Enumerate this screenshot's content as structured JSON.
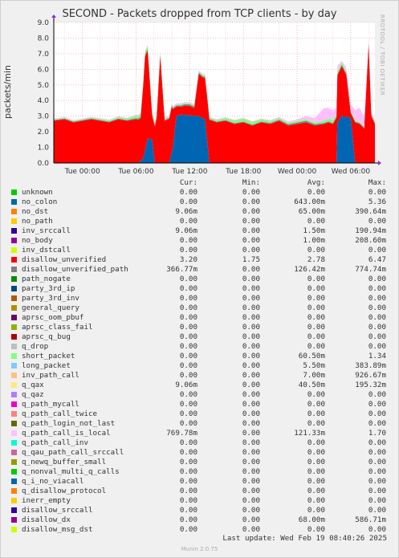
{
  "title": "SECOND - Packets dropped from TCP clients - by day",
  "side_credit": "RRDTOOL / TOBI OETIKER",
  "footer": {
    "last_update": "Last update: Wed Feb 19 08:40:26 2025",
    "generator": "Munin 2.0.75"
  },
  "legend_header": {
    "cur": "Cur:",
    "min": "Min:",
    "avg": "Avg:",
    "max": "Max:"
  },
  "legend": [
    {
      "name": "unknown",
      "color": "#00cc00",
      "cur": "0.00",
      "min": "0.00",
      "avg": "0.00",
      "max": "0.00"
    },
    {
      "name": "no_colon",
      "color": "#0066b3",
      "cur": "0.00",
      "min": "0.00",
      "avg": "643.00m",
      "max": "5.36"
    },
    {
      "name": "no_dst",
      "color": "#ff8000",
      "cur": "9.06m",
      "min": "0.00",
      "avg": "65.00m",
      "max": "390.64m"
    },
    {
      "name": "no_path",
      "color": "#ffcc00",
      "cur": "0.00",
      "min": "0.00",
      "avg": "0.00",
      "max": "0.00"
    },
    {
      "name": "inv_srccall",
      "color": "#330099",
      "cur": "9.06m",
      "min": "0.00",
      "avg": "1.50m",
      "max": "190.94m"
    },
    {
      "name": "no_body",
      "color": "#990099",
      "cur": "0.00",
      "min": "0.00",
      "avg": "1.00m",
      "max": "208.60m"
    },
    {
      "name": "inv_dstcall",
      "color": "#ccff00",
      "cur": "0.00",
      "min": "0.00",
      "avg": "0.00",
      "max": "0.00"
    },
    {
      "name": "disallow_unverified",
      "color": "#ff0000",
      "cur": "3.20",
      "min": "1.75",
      "avg": "2.78",
      "max": "6.47"
    },
    {
      "name": "disallow_unverified_path",
      "color": "#808080",
      "cur": "366.77m",
      "min": "0.00",
      "avg": "126.42m",
      "max": "774.74m"
    },
    {
      "name": "path_nogate",
      "color": "#008f00",
      "cur": "0.00",
      "min": "0.00",
      "avg": "0.00",
      "max": "0.00"
    },
    {
      "name": "party_3rd_ip",
      "color": "#00487d",
      "cur": "0.00",
      "min": "0.00",
      "avg": "0.00",
      "max": "0.00"
    },
    {
      "name": "party_3rd_inv",
      "color": "#b35a00",
      "cur": "0.00",
      "min": "0.00",
      "avg": "0.00",
      "max": "0.00"
    },
    {
      "name": "general_query",
      "color": "#b38f00",
      "cur": "0.00",
      "min": "0.00",
      "avg": "0.00",
      "max": "0.00"
    },
    {
      "name": "aprsc_oom_pbuf",
      "color": "#6b006b",
      "cur": "0.00",
      "min": "0.00",
      "avg": "0.00",
      "max": "0.00"
    },
    {
      "name": "aprsc_class_fail",
      "color": "#8fb300",
      "cur": "0.00",
      "min": "0.00",
      "avg": "0.00",
      "max": "0.00"
    },
    {
      "name": "aprsc_q_bug",
      "color": "#b30000",
      "cur": "0.00",
      "min": "0.00",
      "avg": "0.00",
      "max": "0.00"
    },
    {
      "name": "q_drop",
      "color": "#bebebe",
      "cur": "0.00",
      "min": "0.00",
      "avg": "0.00",
      "max": "0.00"
    },
    {
      "name": "short_packet",
      "color": "#80ff80",
      "cur": "0.00",
      "min": "0.00",
      "avg": "60.50m",
      "max": "1.34"
    },
    {
      "name": "long_packet",
      "color": "#80c9ff",
      "cur": "0.00",
      "min": "0.00",
      "avg": "5.50m",
      "max": "383.89m"
    },
    {
      "name": "inv_path_call",
      "color": "#ffc080",
      "cur": "0.00",
      "min": "0.00",
      "avg": "7.00m",
      "max": "926.67m"
    },
    {
      "name": "q_qax",
      "color": "#ffe680",
      "cur": "9.06m",
      "min": "0.00",
      "avg": "40.50m",
      "max": "195.32m"
    },
    {
      "name": "q_qaz",
      "color": "#aa80ff",
      "cur": "0.00",
      "min": "0.00",
      "avg": "0.00",
      "max": "0.00"
    },
    {
      "name": "q_path_mycall",
      "color": "#ee00cc",
      "cur": "0.00",
      "min": "0.00",
      "avg": "0.00",
      "max": "0.00"
    },
    {
      "name": "q_path_call_twice",
      "color": "#ff8080",
      "cur": "0.00",
      "min": "0.00",
      "avg": "0.00",
      "max": "0.00"
    },
    {
      "name": "q_path_login_not_last",
      "color": "#666600",
      "cur": "0.00",
      "min": "0.00",
      "avg": "0.00",
      "max": "0.00"
    },
    {
      "name": "q_path_call_is_local",
      "color": "#ffbfff",
      "cur": "769.78m",
      "min": "0.00",
      "avg": "121.33m",
      "max": "1.70"
    },
    {
      "name": "q_path_call_inv",
      "color": "#00ffcc",
      "cur": "0.00",
      "min": "0.00",
      "avg": "0.00",
      "max": "0.00"
    },
    {
      "name": "q_qau_path_call_srccall",
      "color": "#cc6699",
      "cur": "0.00",
      "min": "0.00",
      "avg": "0.00",
      "max": "0.00"
    },
    {
      "name": "q_newq_buffer_small",
      "color": "#999900",
      "cur": "0.00",
      "min": "0.00",
      "avg": "0.00",
      "max": "0.00"
    },
    {
      "name": "q_nonval_multi_q_calls",
      "color": "#00cc00",
      "cur": "0.00",
      "min": "0.00",
      "avg": "0.00",
      "max": "0.00"
    },
    {
      "name": "q_i_no_viacall",
      "color": "#0066b3",
      "cur": "0.00",
      "min": "0.00",
      "avg": "0.00",
      "max": "0.00"
    },
    {
      "name": "q_disallow_protocol",
      "color": "#ff8000",
      "cur": "0.00",
      "min": "0.00",
      "avg": "0.00",
      "max": "0.00"
    },
    {
      "name": "inerr_empty",
      "color": "#ffcc00",
      "cur": "0.00",
      "min": "0.00",
      "avg": "0.00",
      "max": "0.00"
    },
    {
      "name": "disallow_srccall",
      "color": "#330099",
      "cur": "0.00",
      "min": "0.00",
      "avg": "0.00",
      "max": "0.00"
    },
    {
      "name": "disallow_dx",
      "color": "#990099",
      "cur": "0.00",
      "min": "0.00",
      "avg": "68.00m",
      "max": "586.71m"
    },
    {
      "name": "disallow_msg_dst",
      "color": "#ccff00",
      "cur": "0.00",
      "min": "0.00",
      "avg": "0.00",
      "max": "0.00"
    }
  ],
  "chart_data": {
    "type": "area",
    "title": "SECOND - Packets dropped from TCP clients - by day",
    "ylabel": "packets/min",
    "xlabel": "",
    "ylim": [
      0,
      9.0
    ],
    "yticks": [
      "0.0",
      "1.0",
      "2.0",
      "3.0",
      "4.0",
      "5.0",
      "6.0",
      "7.0",
      "8.0",
      "9.0"
    ],
    "x_tick_labels": [
      "Tue 00:00",
      "Tue 06:00",
      "Tue 12:00",
      "Tue 18:00",
      "Wed 00:00",
      "Wed 06:00"
    ],
    "x_range_hours": [
      -3.2,
      32.7
    ],
    "x_tick_hours": [
      0,
      6,
      12,
      18,
      24,
      30
    ],
    "grid": true,
    "stacked": true,
    "series": [
      {
        "name": "no_colon",
        "color": "#0066b3",
        "x": [
          -3.2,
          4.5,
          6.2,
          6.8,
          7.3,
          7.8,
          8.1,
          8.6,
          9.7,
          10.1,
          10.5,
          11,
          13,
          13.7,
          14.2,
          15,
          19,
          22,
          25,
          27,
          28.4,
          28.5,
          29,
          30,
          30.5,
          30.6,
          32.7
        ],
        "y": [
          0,
          0,
          0,
          0.3,
          1.6,
          1.5,
          0,
          0,
          0,
          1.0,
          3.0,
          3.1,
          3.0,
          2.8,
          0,
          0,
          0,
          0,
          0,
          0,
          0,
          2.6,
          3.0,
          2.9,
          0,
          0,
          0
        ]
      },
      {
        "name": "disallow_unverified",
        "color": "#ff0000",
        "x": [
          -3.2,
          -2,
          -1,
          0,
          1,
          2,
          3,
          4,
          5,
          6,
          6.5,
          7,
          7.3,
          7.8,
          8.3,
          8.7,
          9.2,
          9.6,
          10,
          10.5,
          11,
          11.5,
          12,
          12.5,
          13,
          13.5,
          14,
          14.5,
          15,
          16,
          17,
          18,
          19,
          20,
          21,
          22,
          23,
          24,
          25,
          26,
          27,
          27.5,
          28,
          28.5,
          29,
          29.5,
          30,
          30.5,
          31,
          31.5,
          32,
          32.3,
          32.7
        ],
        "y": [
          2.7,
          2.8,
          2.6,
          2.7,
          2.8,
          2.7,
          2.6,
          2.8,
          2.7,
          2.8,
          2.7,
          6.0,
          5.6,
          1.5,
          2.9,
          6.9,
          2.7,
          2.8,
          2.9,
          0.6,
          0.5,
          0.6,
          0.6,
          0.5,
          2.7,
          2.6,
          2.8,
          2.7,
          2.6,
          2.7,
          2.5,
          2.6,
          2.4,
          2.6,
          2.5,
          2.7,
          2.4,
          2.5,
          2.6,
          2.4,
          2.5,
          2.6,
          2.5,
          3.0,
          3.2,
          2.7,
          0.3,
          2.6,
          2.5,
          2.2,
          7.6,
          3.0,
          2.5
        ]
      },
      {
        "name": "disallow_unverified_path",
        "color": "#808080",
        "x": [
          -3.2,
          5,
          7,
          9,
          12,
          15,
          20,
          25,
          28,
          29,
          30,
          31,
          32,
          32.7
        ],
        "y": [
          0.05,
          0.05,
          0.1,
          0.05,
          0.1,
          0.05,
          0.05,
          0.1,
          0.05,
          0.1,
          0.05,
          0.05,
          0.1,
          0.05
        ]
      },
      {
        "name": "short_packet",
        "color": "#80ff80",
        "x": [
          -3.2,
          0,
          5,
          7,
          10,
          15,
          18,
          22,
          26,
          28,
          30,
          32.7
        ],
        "y": [
          0.05,
          0.05,
          0.1,
          0.2,
          0.05,
          0.1,
          0.2,
          0.1,
          0.1,
          0.2,
          0.1,
          0.05
        ]
      },
      {
        "name": "q_path_call_is_local",
        "color": "#ffbfff",
        "x": [
          -3.2,
          5,
          8,
          15,
          20,
          24,
          26,
          27,
          28,
          29,
          30,
          31,
          32,
          32.7
        ],
        "y": [
          0.05,
          0.05,
          0.1,
          0.05,
          0.05,
          0.1,
          0.3,
          0.8,
          0.6,
          0.1,
          0.4,
          0.9,
          0.3,
          0.1
        ]
      }
    ]
  }
}
